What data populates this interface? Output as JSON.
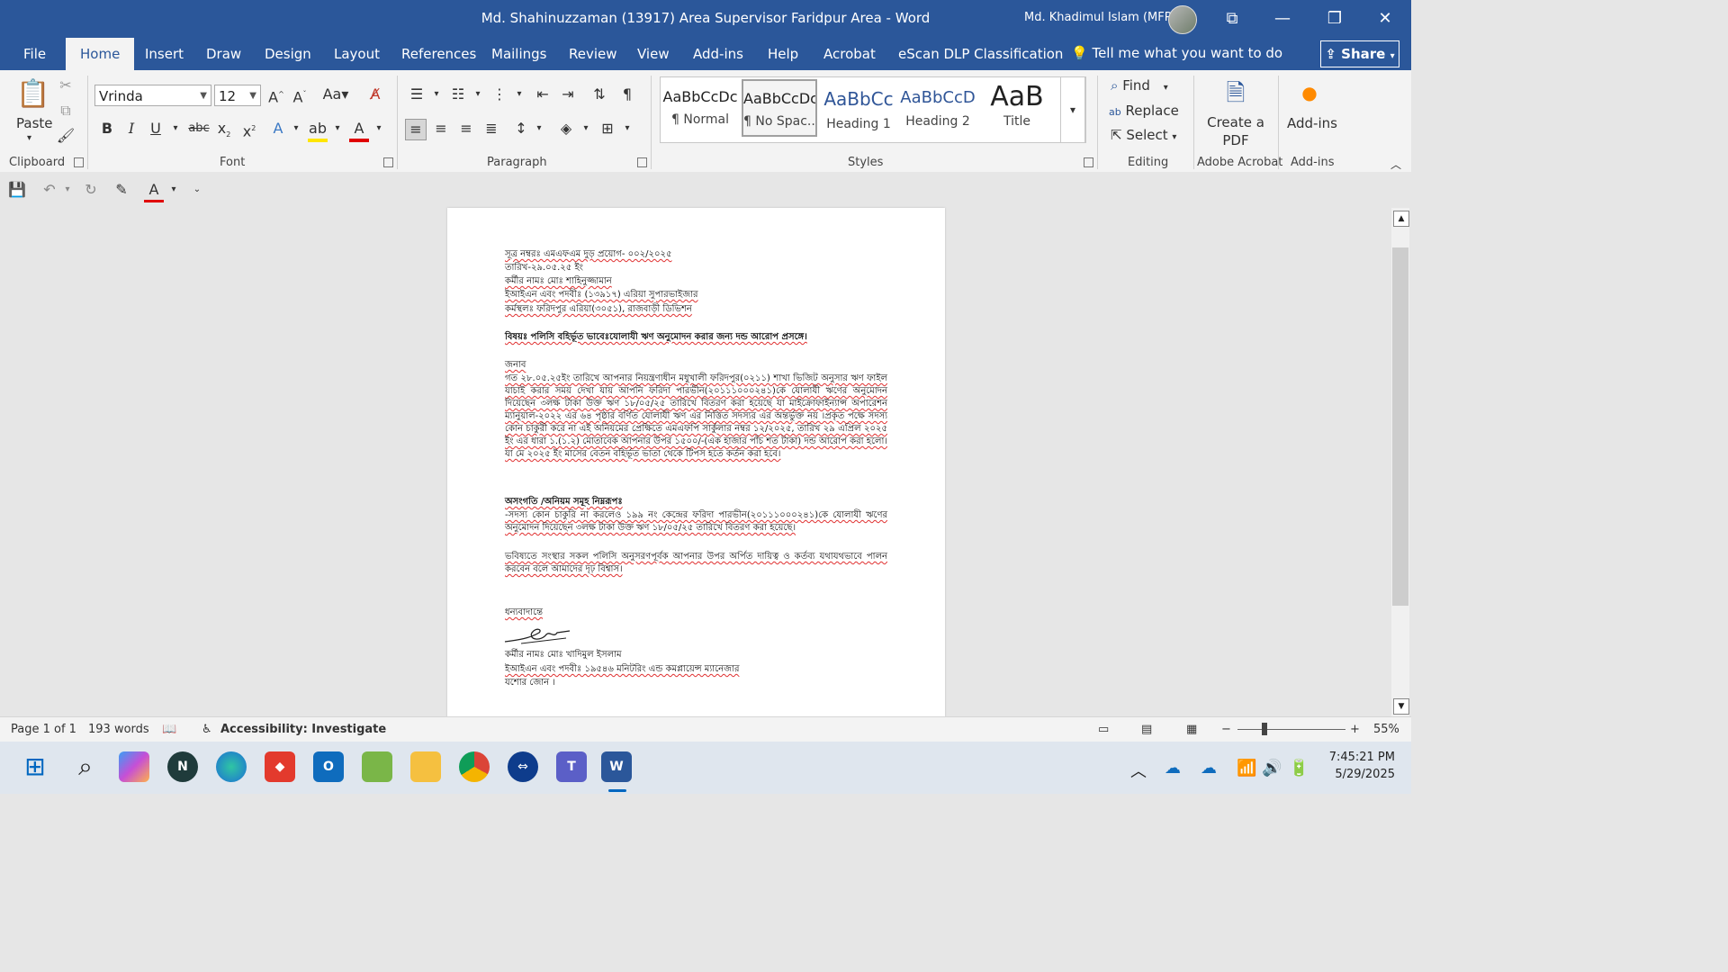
{
  "window": {
    "title": "Md. Shahinuzzaman (13917) Area Supervisor Faridpur Area  -  Word",
    "user": "Md. Khadimul Islam (MFP)",
    "controls": [
      "⧉",
      "—",
      "❐",
      "✕"
    ]
  },
  "tabs": [
    "File",
    "Home",
    "Insert",
    "Draw",
    "Design",
    "Layout",
    "References",
    "Mailings",
    "Review",
    "View",
    "Add-ins",
    "Help",
    "Acrobat"
  ],
  "active_tab": "Home",
  "dlp_label": "eScan DLP Classification",
  "tell_me": "Tell me what you want to do",
  "share_label": "Share",
  "ribbon": {
    "clipboard": {
      "paste": "Paste",
      "group": "Clipboard"
    },
    "font": {
      "name": "Vrinda",
      "size": "12",
      "group": "Font"
    },
    "paragraph": {
      "group": "Paragraph"
    },
    "styles": {
      "group": "Styles",
      "items": [
        {
          "preview": "AaBbCcDc",
          "name": "¶ Normal"
        },
        {
          "preview": "AaBbCcDc",
          "name": "¶ No Spac..."
        },
        {
          "preview": "AaBbCc",
          "name": "Heading 1"
        },
        {
          "preview": "AaBbCcD",
          "name": "Heading 2"
        },
        {
          "preview": "AaB",
          "name": "Title"
        }
      ]
    },
    "editing": {
      "find": "Find",
      "replace": "Replace",
      "select": "Select",
      "group": "Editing"
    },
    "acrobat": {
      "create": "Create a PDF",
      "group": "Adobe Acrobat"
    },
    "addins": {
      "label": "Add-ins",
      "group": "Add-ins"
    }
  },
  "document": {
    "lines": [
      "সূত্র নম্বরঃ এমএফএম দুড় প্রয়োগ- ০০২/২০২৫",
      "তারিখ-২৯.০৫.২৫ ইং",
      "কর্মীর নামঃ মোঃ শাহিনুজ্জামান",
      "ইআইএন এবং পদবীঃ (১৩৯১৭) এরিয়া সুপারভাইজার",
      "কর্মস্থলঃ ফরিদপুর এরিয়া(৩০৫১), রাজবাড়ী ডিভিশন"
    ],
    "subject": "বিষয়ঃ পলিসি বহির্ভূত ভাবেঃযোলাযী ঋণ অনুমোদন করার জন্য দন্ড আরোপ প্রসঙ্গে।",
    "salutation": "জনাব",
    "para1": "গত ২৮.০৫.২৫ইং তারিখে আপনার নিয়ন্ত্রণাধীন মধুখালী ফরিদপুর(০২১১) শাখা ভিজিট অনুসার ঋণ ফাইল যাচাই করার সময় দেখা যায় আপনি ফরিদা পারভীন(২০১১১০০০২৪১)কে যোলাযী ঋণের অনুমোদন দিয়েছেন ৩লক্ষ টাকা উক্ত ঋণ ১৮/০৫/২৫ তারিখে বিতরণ করা হয়েছে যা মাইক্রোফাইন্যান্স অপারেশন ম্যানুয়াল-২০২২ এর ৬৪ পৃষ্ঠার বর্ণিত যোলাযী ঋণ এর নিত্তিত সদস্যর এর অন্তর্ভুক্ত নয় ।প্রকৃত পক্ষে সদস্য কোন চাকুরী করে না এই অনিয়মের প্রেক্ষিতে এমএফপি সার্কুলার নম্বর ১২/২০২৫, তারিখ ২৯ এপ্রিল ২০২৫ ইং এর ধারা ১.(১.২) মোতাবেক আপনার উপর ১৫০০/-(এক হাজার পাঁচ শত টাকা) দন্ড আরোপ করা হলো। যা মে ২০২৫ ইং মাসের বেতন বহির্ভূত ভাতা থেকে টিপস হতে কর্তন করা হবে।",
    "heading2": "অসংগতি /অনিয়ম সমূহ নিম্নরূপঃ",
    "para2": "-সদস্য কোন চাকুরি না করলেও ১৯৯ নং কেন্দ্রের ফরিদা পারভীন(২০১১১০০০২৪১)কে যোলাযী ঋণের অনুমোদন দিয়েছেন ৩লক্ষ টাকা উক্ত ঋণ ১৮/০৫/২৫ তারিখে বিতরণ করা হয়েছে।",
    "para3": "ভবিষ্যতে সংস্থার সকল পলিসি অনুসরণপূর্বক আপনার উপর অর্পিত দায়িত্ব ও কর্তব্য যথাযথভাবে পালন করবেন বলে আমাদের দৃঢ় বিশ্বাস।",
    "closing": "ধন্যবাদান্তে",
    "sign_lines": [
      "কর্মীর নামঃ মোঃ খাদিমুল ইসলাম",
      "ইআইএন এবং পদবীঃ ১৯৫৪৬ মনিটরিং এন্ড কমপ্লায়েন্স ম্যানেজার",
      "যশোর জোন ।"
    ]
  },
  "status": {
    "page": "Page 1 of 1",
    "words": "193 words",
    "accessibility": "Accessibility: Investigate",
    "zoom": "55%"
  },
  "tray": {
    "time": "7:45:21 PM",
    "date": "5/29/2025"
  }
}
